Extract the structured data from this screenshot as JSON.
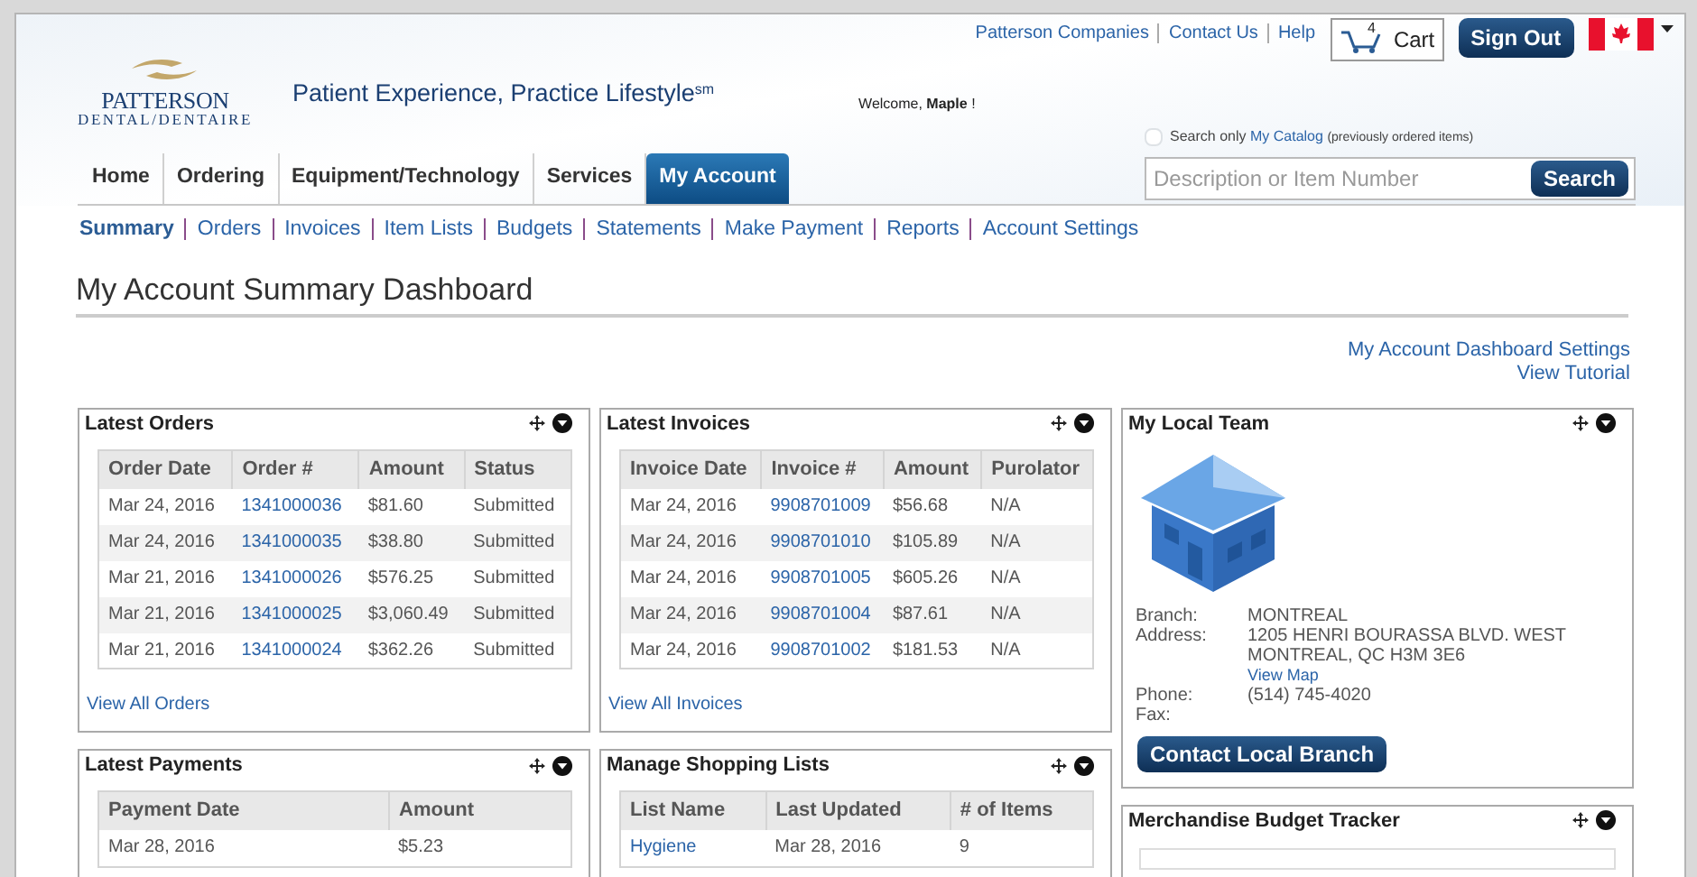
{
  "header": {
    "logo_name": "PATTERSON",
    "logo_sub": "DENTAL/DENTAIRE",
    "tagline": "Patient Experience, Practice Lifestyle$^{sm}$",
    "welcome": "Welcome, **Maple** !"
  },
  "top_links": [
    "Patterson Companies",
    "Contact Us",
    "Help"
  ],
  "cart": {
    "count": "4",
    "label": "Cart"
  },
  "sign_out": "Sign Out",
  "search": {
    "catalog_checked": false,
    "prefix": "Search only",
    "catalog_link": "My Catalog",
    "note": "(previously ordered items)",
    "placeholder": "Description or Item Number",
    "button": "Search"
  },
  "nav_tabs": [
    {
      "label": "Home",
      "selected": false
    },
    {
      "label": "Ordering",
      "selected": false
    },
    {
      "label": "Equipment/Technology",
      "selected": false
    },
    {
      "label": "Services",
      "selected": false
    },
    {
      "label": "My Account",
      "selected": true
    }
  ],
  "subnav": [
    {
      "label": "Summary",
      "selected": true
    },
    {
      "label": "Orders",
      "selected": false
    },
    {
      "label": "Invoices",
      "selected": false
    },
    {
      "label": "Item Lists",
      "selected": false
    },
    {
      "label": "Budgets",
      "selected": false
    },
    {
      "label": "Statements",
      "selected": false
    },
    {
      "label": "Make Payment",
      "selected": false
    },
    {
      "label": "Reports",
      "selected": false
    },
    {
      "label": "Account Settings",
      "selected": false
    }
  ],
  "page_title": "My Account Summary Dashboard",
  "dashboard_links": [
    "My Account Dashboard Settings",
    "View Tutorial"
  ],
  "columns": [
    [
      {
        "kind": "table",
        "title": "Latest Orders",
        "columns": [
          {
            "label": "Order Date",
            "kind": "text"
          },
          {
            "label": "Order #",
            "kind": "link"
          },
          {
            "label": "Amount",
            "kind": "text"
          },
          {
            "label": "Status",
            "kind": "text"
          }
        ],
        "rows": [
          [
            "Mar 24, 2016",
            "1341000036",
            "$81.60",
            "Submitted"
          ],
          [
            "Mar 24, 2016",
            "1341000035",
            "$38.80",
            "Submitted"
          ],
          [
            "Mar 21, 2016",
            "1341000026",
            "$576.25",
            "Submitted"
          ],
          [
            "Mar 21, 2016",
            "1341000025",
            "$3,060.49",
            "Submitted"
          ],
          [
            "Mar 21, 2016",
            "1341000024",
            "$362.26",
            "Submitted"
          ]
        ],
        "footer_link": "View All Orders"
      },
      {
        "kind": "table",
        "title": "Latest Payments",
        "columns": [
          {
            "label": "Payment Date",
            "kind": "text"
          },
          {
            "label": "Amount",
            "kind": "text"
          }
        ],
        "rows": [
          [
            "Mar 28, 2016",
            "$5.23"
          ]
        ]
      }
    ],
    [
      {
        "kind": "table",
        "title": "Latest Invoices",
        "columns": [
          {
            "label": "Invoice Date",
            "kind": "text"
          },
          {
            "label": "Invoice #",
            "kind": "link"
          },
          {
            "label": "Amount",
            "kind": "text"
          },
          {
            "label": "Purolator",
            "kind": "text"
          }
        ],
        "rows": [
          [
            "Mar 24, 2016",
            "9908701009",
            "$56.68",
            "N/A"
          ],
          [
            "Mar 24, 2016",
            "9908701010",
            "$105.89",
            "N/A"
          ],
          [
            "Mar 24, 2016",
            "9908701005",
            "$605.26",
            "N/A"
          ],
          [
            "Mar 24, 2016",
            "9908701004",
            "$87.61",
            "N/A"
          ],
          [
            "Mar 24, 2016",
            "9908701002",
            "$181.53",
            "N/A"
          ]
        ],
        "footer_link": "View All Invoices"
      },
      {
        "kind": "table",
        "title": "Manage Shopping Lists",
        "columns": [
          {
            "label": "List Name",
            "kind": "link"
          },
          {
            "label": "Last Updated",
            "kind": "text"
          },
          {
            "label": "# of Items",
            "kind": "text"
          }
        ],
        "rows": [
          [
            "Hygiene",
            "Mar 28, 2016",
            "9"
          ]
        ]
      }
    ],
    [
      {
        "kind": "team",
        "title": "My Local Team",
        "details": [
          {
            "label": "Branch:",
            "lines": [
              "MONTREAL"
            ]
          },
          {
            "label": "Address:",
            "lines": [
              "1205 HENRI BOURASSA BLVD. WEST",
              "MONTREAL, QC H3M 3E6"
            ],
            "link": "View Map"
          },
          {
            "label": "Phone:",
            "lines": [
              "(514) 745-4020"
            ]
          },
          {
            "label": "Fax:"
          }
        ],
        "button": "Contact Local Branch"
      },
      {
        "kind": "tracker",
        "title": "Merchandise Budget Tracker"
      }
    ]
  ]
}
